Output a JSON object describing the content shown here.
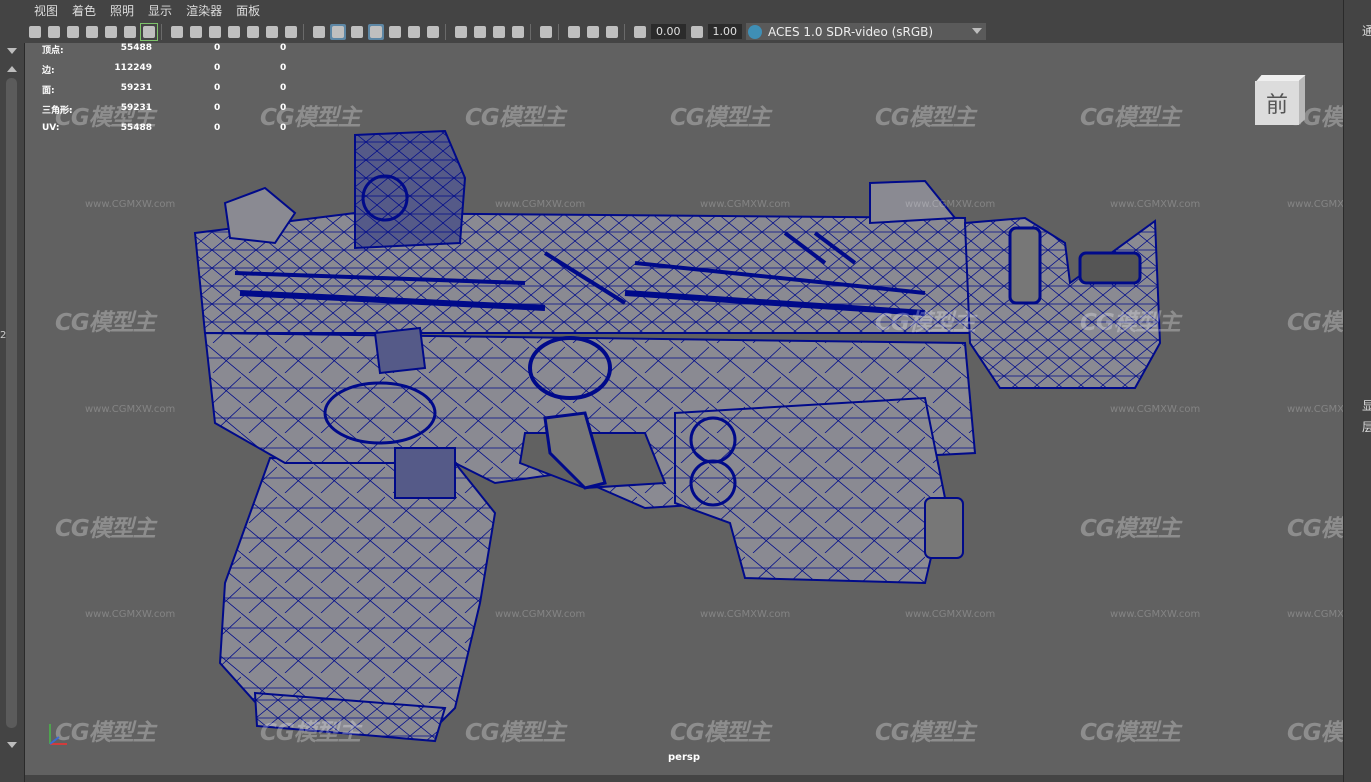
{
  "menu": [
    "视图",
    "着色",
    "照明",
    "显示",
    "渲染器",
    "面板"
  ],
  "toolbar": {
    "exposure_value": "0.00",
    "gamma_value": "1.00",
    "color_space": "ACES 1.0 SDR-video (sRGB)"
  },
  "hud": {
    "rows": [
      {
        "label": "顶点:",
        "value": "55488",
        "c2": "0",
        "c3": "0"
      },
      {
        "label": "边:",
        "value": "112249",
        "c2": "0",
        "c3": "0"
      },
      {
        "label": "面:",
        "value": "59231",
        "c2": "0",
        "c3": "0"
      },
      {
        "label": "三角形:",
        "value": "59231",
        "c2": "0",
        "c3": "0"
      },
      {
        "label": "UV:",
        "value": "55488",
        "c2": "0",
        "c3": "0"
      }
    ]
  },
  "viewcube_label": "前",
  "camera_label": "persp",
  "watermark": {
    "logo": "CG模型主",
    "url": "www.CGMXW.com"
  },
  "right_panel": {
    "top_char": "通",
    "mid_char_1": "显",
    "mid_char_2": "层"
  },
  "left_panel": {
    "side_digit": "2"
  },
  "colors": {
    "wireframe": "#000a8a",
    "viewport_bg": "#616161",
    "mesh_fill": "#8a8a92"
  }
}
